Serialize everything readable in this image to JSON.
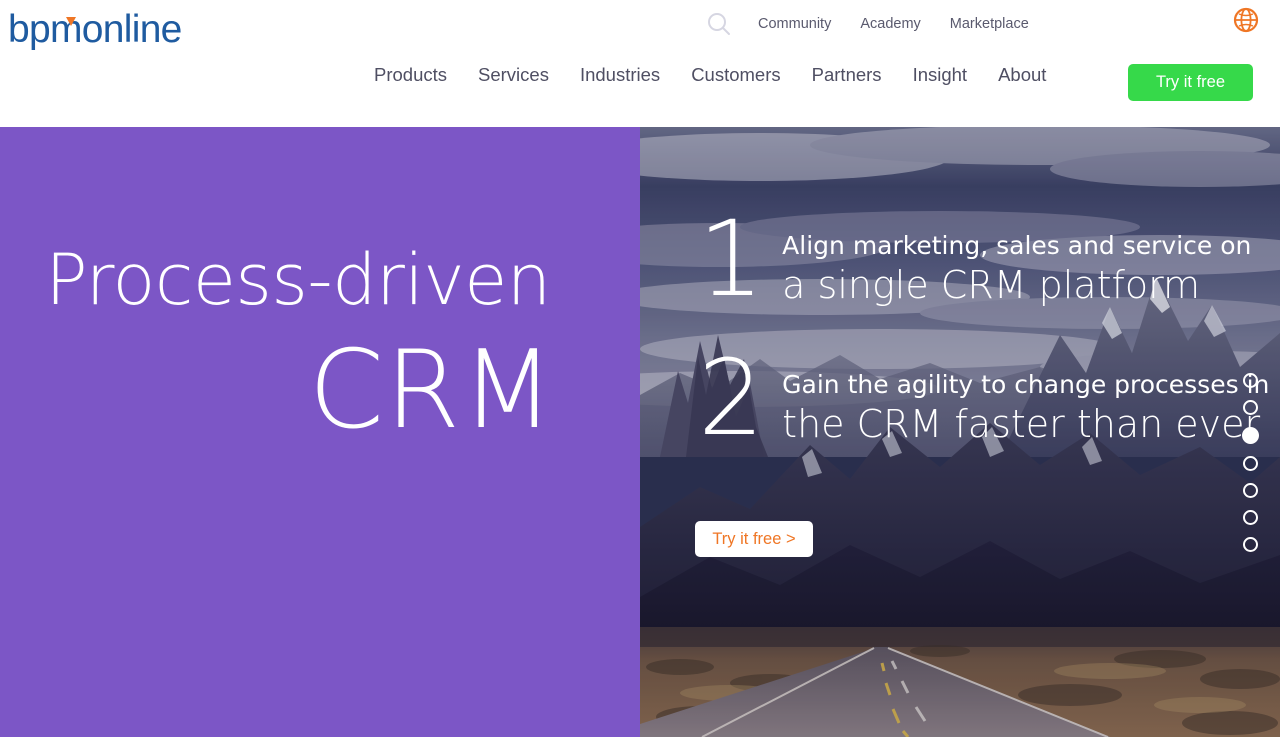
{
  "site": {
    "logo_text": "bpm online",
    "logo_primary": "bpm",
    "logo_secondary": "online",
    "logo_color": "#1f5ba0",
    "accent_color": "#ef7625"
  },
  "header": {
    "utility_nav": [
      {
        "label": "Community"
      },
      {
        "label": "Academy"
      },
      {
        "label": "Marketplace"
      }
    ],
    "search_icon": "search-icon",
    "language_icon": "globe-icon",
    "main_nav": [
      {
        "label": "Products"
      },
      {
        "label": "Services"
      },
      {
        "label": "Industries"
      },
      {
        "label": "Customers"
      },
      {
        "label": "Partners"
      },
      {
        "label": "Insight"
      },
      {
        "label": "About"
      }
    ],
    "cta": {
      "label": "Try it free",
      "color": "#36d94a"
    }
  },
  "hero": {
    "panel": {
      "background_color": "#7c56c6",
      "headline_line1": "Process-driven",
      "headline_line2": "CRM"
    },
    "slide": {
      "points": [
        {
          "number": "1",
          "line_small": "Align marketing, sales and service on",
          "line_big": "a single CRM platform"
        },
        {
          "number": "2",
          "line_small": "Gain the agility to change processes in",
          "line_big": "the CRM faster than ever"
        }
      ],
      "cta": {
        "label": "Try it free >",
        "text_color": "#ef7625",
        "background": "#ffffff"
      },
      "pagination": {
        "total": 7,
        "active_index": 3
      }
    }
  }
}
